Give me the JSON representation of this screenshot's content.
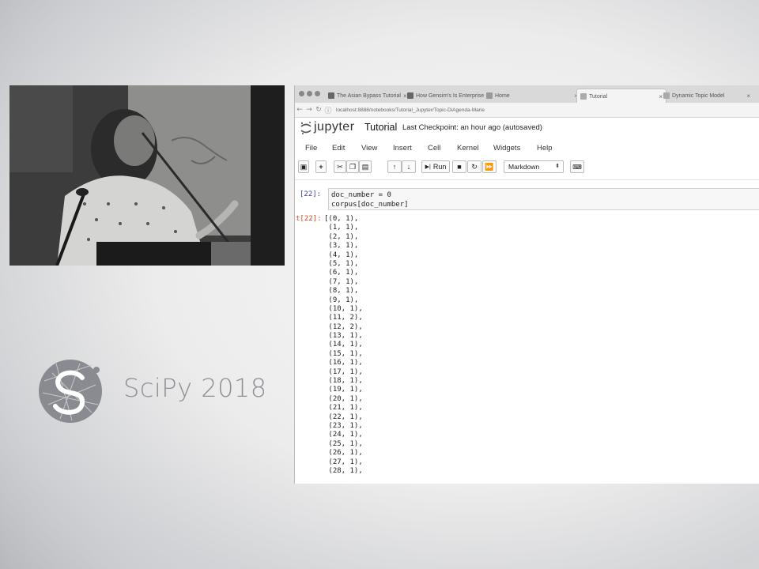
{
  "slide": {
    "brand": "SciPy 2018"
  },
  "browser": {
    "tabs": [
      {
        "label": "The Asian Bypass Tutorial"
      },
      {
        "label": "How Gensim's Is Enterprise"
      },
      {
        "label": "Home"
      },
      {
        "label": "Tutorial"
      },
      {
        "label": "Dynamic Topic Model"
      }
    ],
    "url": "localhost:8888/notebooks/Tutorial_Jupyter/Topic-DiAgenda-Marie"
  },
  "notebook": {
    "logo_word": "jupyter",
    "name": "Tutorial",
    "checkpoint": "Last Checkpoint: an hour ago  (autosaved)",
    "menu": [
      "File",
      "Edit",
      "View",
      "Insert",
      "Cell",
      "Kernel",
      "Widgets",
      "Help"
    ],
    "toolbar": {
      "run_label": "Run",
      "cell_type": "Markdown"
    },
    "cell": {
      "in_prompt": "[22]:",
      "code": [
        "doc_number = 0",
        "corpus[doc_number]"
      ],
      "out_prompt": "t[22]:",
      "output": [
        "[(0, 1),",
        " (1, 1),",
        " (2, 1),",
        " (3, 1),",
        " (4, 1),",
        " (5, 1),",
        " (6, 1),",
        " (7, 1),",
        " (8, 1),",
        " (9, 1),",
        " (10, 1),",
        " (11, 2),",
        " (12, 2),",
        " (13, 1),",
        " (14, 1),",
        " (15, 1),",
        " (16, 1),",
        " (17, 1),",
        " (18, 1),",
        " (19, 1),",
        " (20, 1),",
        " (21, 1),",
        " (22, 1),",
        " (23, 1),",
        " (24, 1),",
        " (25, 1),",
        " (26, 1),",
        " (27, 1),",
        " (28, 1),"
      ]
    }
  },
  "icons": {
    "save": "save-icon",
    "add": "plus-icon",
    "cut": "scissors-icon",
    "copy": "copy-icon",
    "paste": "paste-icon",
    "up": "arrow-up-icon",
    "down": "arrow-down-icon",
    "run": "run-icon",
    "stop": "stop-icon",
    "restart": "restart-icon",
    "fast_forward": "fast-forward-icon",
    "keyboard": "keyboard-icon"
  }
}
